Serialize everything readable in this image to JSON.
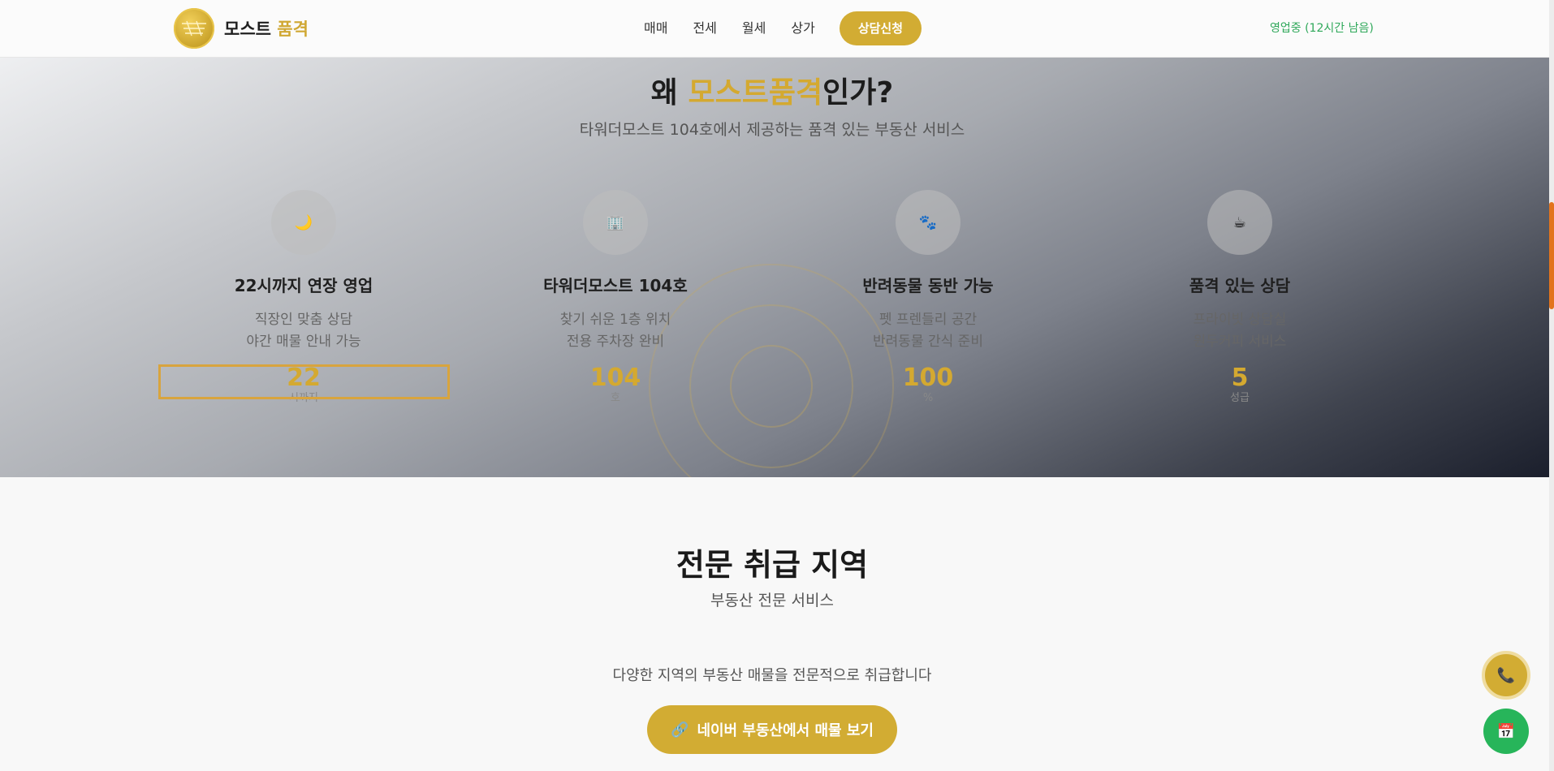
{
  "header": {
    "logo_text_main": "모스트",
    "logo_text_accent": "품격",
    "nav": [
      {
        "label": "매매"
      },
      {
        "label": "전세"
      },
      {
        "label": "월세"
      },
      {
        "label": "상가"
      }
    ],
    "cta_label": "상담신청",
    "status_text": "영업중 (12시간 남음)"
  },
  "why": {
    "title_prefix": "왜",
    "title_highlight": "모스트품격",
    "title_suffix": "인가?",
    "subtitle": "타워더모스트 104호에서 제공하는 품격 있는 부동산 서비스",
    "features": [
      {
        "icon": "moon-icon",
        "glyph": "🌙",
        "title": "22시까지 연장 영업",
        "desc1": "직장인 맞춤 상담",
        "desc2": "야간 매물 안내 가능",
        "number": "22",
        "unit": "시까지"
      },
      {
        "icon": "building-icon",
        "glyph": "🏢",
        "title": "타워더모스트 104호",
        "desc1": "찾기 쉬운 1층 위치",
        "desc2": "전용 주차장 완비",
        "number": "104",
        "unit": "호"
      },
      {
        "icon": "paw-icon",
        "glyph": "🐾",
        "title": "반려동물 동반 가능",
        "desc1": "펫 프렌들리 공간",
        "desc2": "반려동물 간식 준비",
        "number": "100",
        "unit": "%"
      },
      {
        "icon": "coffee-icon",
        "glyph": "☕",
        "title": "품격 있는 상담",
        "desc1": "프라이빗 상담실",
        "desc2": "원두커피 서비스",
        "number": "5",
        "unit": "성급"
      }
    ]
  },
  "regions": {
    "title": "전문 취급 지역",
    "subtitle": "부동산 전문 서비스",
    "description": "다양한 지역의 부동산 매물을 전문적으로 취급합니다",
    "button_label": "네이버 부동산에서 매물 보기",
    "button_glyph": "🔗"
  },
  "floating": {
    "phone_glyph": "📞",
    "calendar_glyph": "📅"
  },
  "colors": {
    "accent_gold": "#d2ac33",
    "status_green": "#2fa85a",
    "calendar_green": "#27b55a"
  }
}
